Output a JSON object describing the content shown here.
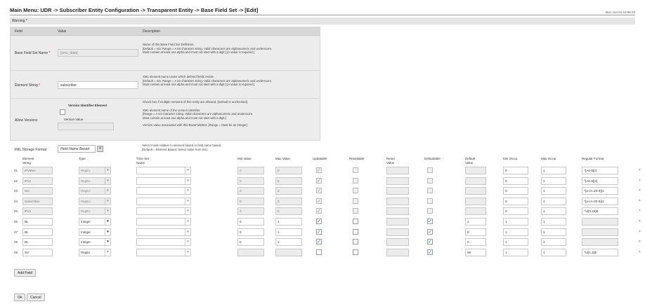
{
  "header": {
    "title": "Main Menu: UDR -> Subscriber Entity Configuration -> Transparent Entity -> Base Field Set -> [Edit]",
    "timestamp": "Mon Jun 01 10:06:23"
  },
  "warning": "Warning *",
  "field_table": {
    "columns": [
      "Field",
      "Value",
      "Description"
    ],
    "base_field_set_name": {
      "label": "Base Field Set Name",
      "value": "[sms_data]",
      "description": [
        "Name of this Base Field Set Definition.",
        "[Default = n/a; Range = A 64 character string. Valid characters are alphanumeric and underscore.",
        "Must contain at least one alpha and must not start with a digit.] [A value is required.]"
      ]
    },
    "element_string": {
      "label": "Element String",
      "value": "subscriber",
      "description": [
        "XML element name under which defined fields reside.",
        "[Default = n/a; Range = A 64 character string. Valid characters are alphanumeric and underscore.",
        "Must contain at least one alpha and must not start with a digit.] [A value is required.]"
      ]
    },
    "allow_versions": {
      "label": "Allow Versions",
      "sub_label_1": "Version Identifier Element",
      "sub_label_2": "Version Value",
      "description_1": "Check box if multiple versions of this entity are allowed. [Default is unchecked]",
      "description_2": [
        "XML element name of the version identifier.",
        "[Range = A 64 character string. Valid characters are alphanumeric and underscore.",
        "Must contain at least one alpha and must not start with a digit.]"
      ],
      "description_3": "Version value associated with this BaseFieldSet. [Range = Must be an integer]"
    },
    "xml_storage_format": {
      "label": "XML Storage Format",
      "value": "Field Name Based",
      "description": [
        "Select mode relative to element based or field name based.",
        "[Default = Element Based; Select value from list.]"
      ]
    }
  },
  "grid": {
    "headers": {
      "element_string": [
        "Element",
        "String"
      ],
      "type": [
        "Type"
      ],
      "time_set_name": [
        "Time Set",
        "Name"
      ],
      "min_value": [
        "Min Value"
      ],
      "max_value": [
        "Max Value"
      ],
      "updatable": [
        "Updatable"
      ],
      "resettable": [
        "Resettable"
      ],
      "reset_value": [
        "Reset",
        "Value"
      ],
      "defaultable": [
        "Defaultable"
      ],
      "default_value": [
        "Default",
        "Value"
      ],
      "min_occur": [
        "Min Occur"
      ],
      "max_occur": [
        "Max Occur"
      ],
      "regular_format": [
        "Regular Format"
      ]
    },
    "rows": [
      {
        "num": "01",
        "element": "IPv6NH",
        "type": "RegEx",
        "min": "0",
        "max": "0",
        "updatable": true,
        "resettable": false,
        "defaultable": false,
        "default": "",
        "min_occur": "0",
        "max_occur": "1",
        "format": "^[A0-9]{4",
        "disabled": true
      },
      {
        "num": "02",
        "element": "IPv2",
        "type": "RegEx",
        "min": "0",
        "max": "0",
        "updatable": true,
        "resettable": false,
        "defaultable": false,
        "default": "",
        "min_occur": "0",
        "max_occur": "1",
        "format": "^[A0-9]{4}",
        "disabled": true
      },
      {
        "num": "03",
        "element": "SoI",
        "type": "RegEx",
        "min": "0",
        "max": "0",
        "updatable": true,
        "resettable": false,
        "defaultable": false,
        "default": "",
        "min_occur": "0",
        "max_occur": "1",
        "format": "^[a-zA-Z0-9]{1",
        "disabled": true
      },
      {
        "num": "04",
        "element": "Subscriber",
        "type": "RegEx",
        "min": "0",
        "max": "0",
        "updatable": true,
        "resettable": false,
        "defaultable": false,
        "default": "",
        "min_occur": "0",
        "max_occur": "1",
        "format": "^[a-zA-Z0-9]{1",
        "disabled": true
      },
      {
        "num": "05",
        "element": "IPv2",
        "type": "RegEx",
        "min": "0",
        "max": "0",
        "updatable": true,
        "resettable": false,
        "defaultable": false,
        "default": "",
        "min_occur": "0",
        "max_occur": "1",
        "format": "^\\d{3,15}$",
        "disabled": true
      },
      {
        "num": "06",
        "element": "BL",
        "type": "Integer",
        "min": "0",
        "max": "1",
        "updatable": true,
        "resettable": false,
        "defaultable": true,
        "default": "1",
        "min_occur": "1",
        "max_occur": "1",
        "format": "",
        "disabled": false
      },
      {
        "num": "07",
        "element": "BL",
        "type": "Integer",
        "min": "0",
        "max": "1",
        "updatable": true,
        "resettable": false,
        "defaultable": true,
        "default": "0",
        "min_occur": "1",
        "max_occur": "1",
        "format": "",
        "disabled": false
      },
      {
        "num": "08",
        "element": "BL",
        "type": "Integer",
        "min": "0",
        "max": "1",
        "updatable": true,
        "resettable": false,
        "defaultable": true,
        "default": "0",
        "min_occur": "1",
        "max_occur": "1",
        "format": "",
        "disabled": false
      },
      {
        "num": "09",
        "element": "SV",
        "type": "RegEx",
        "min": "",
        "max": "",
        "updatable": false,
        "resettable": false,
        "defaultable": true,
        "default": "99",
        "min_occur": "1",
        "max_occur": "1",
        "format": "^\\d{1,3}$",
        "disabled": false
      }
    ],
    "delete_glyph": "×",
    "check_glyph": "✓",
    "arrow_glyph": "▾"
  },
  "buttons": {
    "add_field": "Add Field",
    "ok": "Ok",
    "cancel": "Cancel"
  }
}
